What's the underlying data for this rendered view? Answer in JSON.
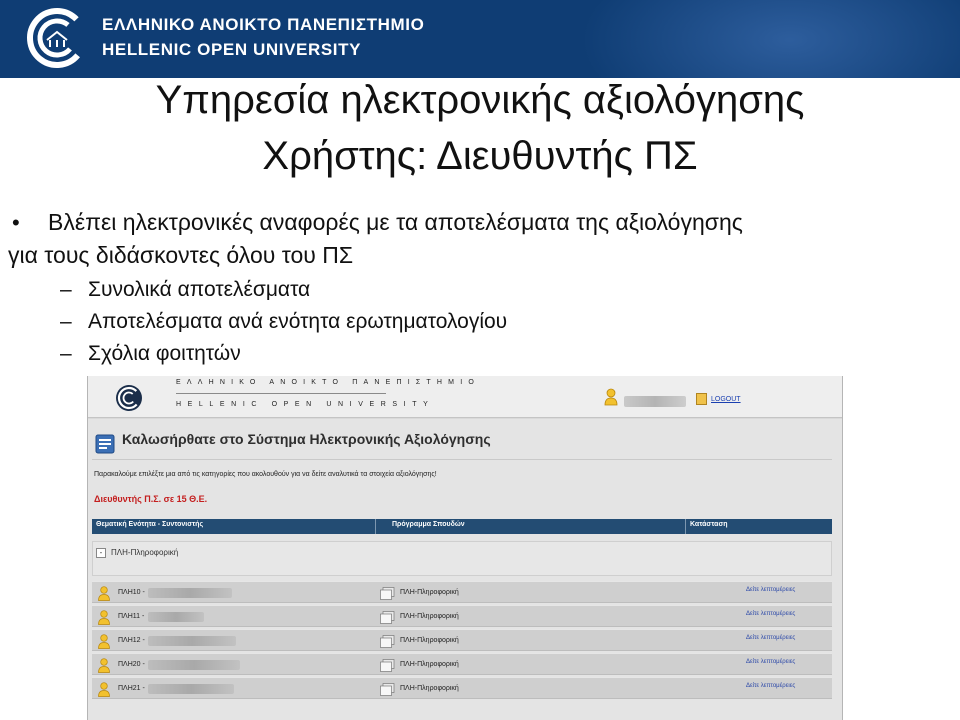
{
  "banner": {
    "title_gr": "ΕΛΛΗΝΙΚΟ ΑΝΟΙΚΤΟ ΠΑΝΕΠΙΣΤΗΜΙΟ",
    "title_en": "HELLENIC OPEN UNIVERSITY",
    "logo_icon": "hou-logo-icon",
    "background_color": "#0f3d74"
  },
  "slide": {
    "title": "Υπηρεσία ηλεκτρονικής αξιολόγησης",
    "subtitle": "Χρήστης: Διευθυντής ΠΣ",
    "bullet": {
      "marker": "•",
      "line1": "Βλέπει ηλεκτρονικές αναφορές με τα αποτελέσματα της αξιολόγησης",
      "line2": "για τους διδάσκοντες όλου του ΠΣ"
    },
    "sub_bullets": [
      {
        "dash": "–",
        "text": "Συνολικά αποτελέσματα"
      },
      {
        "dash": "–",
        "text": "Αποτελέσματα ανά ενότητα ερωτηματολογίου"
      },
      {
        "dash": "–",
        "text": "Σχόλια φοιτητών"
      }
    ]
  },
  "app": {
    "header": {
      "name_gr": "ΕΛΛΗΝΙΚΟ ΑΝΟΙΚΤΟ ΠΑΝΕΠΙΣΤΗΜΙΟ",
      "name_en": "HELLENIC OPEN UNIVERSITY",
      "logout_label": "LOGOUT"
    },
    "welcome_title": "Καλωσήρθατε στο Σύστημα Ηλεκτρονικής Αξιολόγησης",
    "instructions": "Παρακαλούμε επιλέξτε μια από τις κατηγορίες που ακολουθούν για να δείτε αναλυτικά τα στοιχεία αξιολόγησης!",
    "role_label": "Διευθυντής Π.Σ. σε 15 Θ.Ε.",
    "table": {
      "columns": [
        "Θεματική Ενότητα - Συντονιστής",
        "Πρόγραμμα Σπουδών",
        "Κατάσταση"
      ],
      "group": {
        "toggle": "-",
        "label": "ΠΛΗ-Πληροφορική"
      },
      "rows": [
        {
          "code": "ΠΛΗ10 -",
          "program": "ΠΛΗ-Πληροφορική",
          "action": "Δείτε λεπτομέρειες"
        },
        {
          "code": "ΠΛΗ11 -",
          "program": "ΠΛΗ-Πληροφορική",
          "action": "Δείτε λεπτομέρειες"
        },
        {
          "code": "ΠΛΗ12 -",
          "program": "ΠΛΗ-Πληροφορική",
          "action": "Δείτε λεπτομέρειες"
        },
        {
          "code": "ΠΛΗ20 -",
          "program": "ΠΛΗ-Πληροφορική",
          "action": "Δείτε λεπτομέρειες"
        },
        {
          "code": "ΠΛΗ21 -",
          "program": "ΠΛΗ-Πληροφορική",
          "action": "Δείτε λεπτομέρειες"
        }
      ]
    },
    "colors": {
      "table_header": "#234c73",
      "role_label": "#c41e1e",
      "link": "#2a47a8"
    }
  }
}
